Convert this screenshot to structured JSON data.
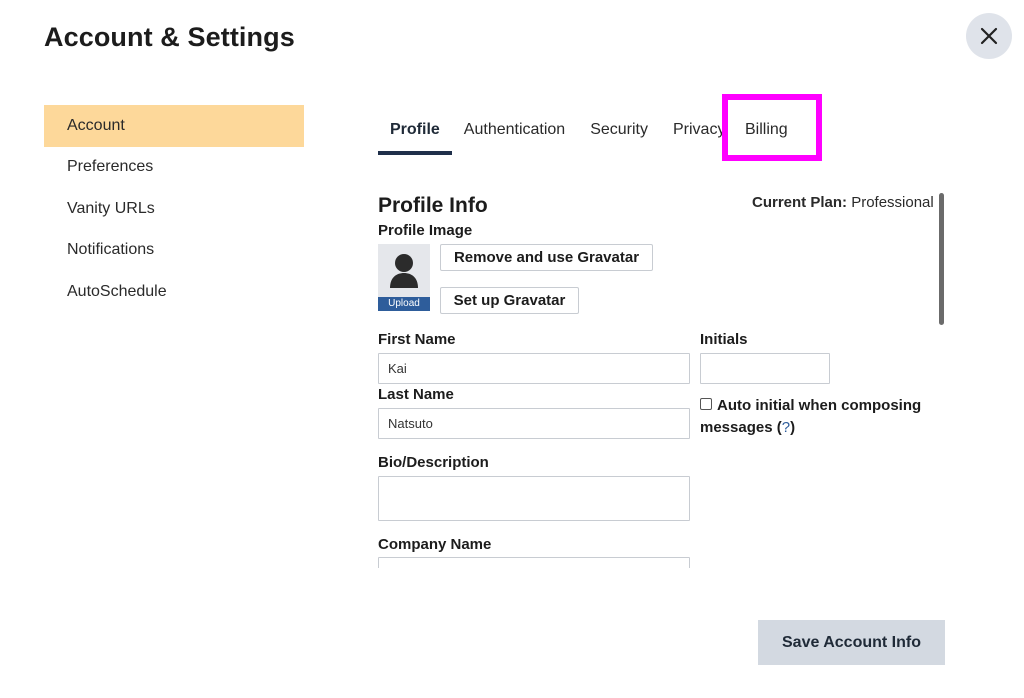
{
  "header": {
    "title": "Account & Settings"
  },
  "sidebar": {
    "items": [
      {
        "label": "Account"
      },
      {
        "label": "Preferences"
      },
      {
        "label": "Vanity URLs"
      },
      {
        "label": "Notifications"
      },
      {
        "label": "AutoSchedule"
      }
    ]
  },
  "tabs": [
    {
      "label": "Profile"
    },
    {
      "label": "Authentication"
    },
    {
      "label": "Security"
    },
    {
      "label": "Privacy"
    },
    {
      "label": "Billing"
    }
  ],
  "profile": {
    "section_title": "Profile Info",
    "plan_label": "Current Plan:",
    "plan_value": "Professional",
    "image_label": "Profile Image",
    "upload_label": "Upload",
    "remove_gravatar_label": "Remove and use Gravatar",
    "setup_gravatar_label": "Set up Gravatar",
    "first_name_label": "First Name",
    "first_name_value": "Kai",
    "initials_label": "Initials",
    "initials_value": "",
    "last_name_label": "Last Name",
    "last_name_value": "Natsuto",
    "auto_initial_label": "Auto initial when composing messages",
    "auto_initial_help_open": "(",
    "auto_initial_help": "?",
    "auto_initial_help_close": ")",
    "bio_label": "Bio/Description",
    "bio_value": "",
    "company_label": "Company Name"
  },
  "footer": {
    "save_label": "Save Account Info"
  },
  "colors": {
    "active_sidebar": "#fdd89a",
    "tab_underline": "#1f2f4a",
    "highlight": "#ff00ff",
    "upload_strip": "#2e5d9b",
    "save_button": "#d3d9e1"
  }
}
